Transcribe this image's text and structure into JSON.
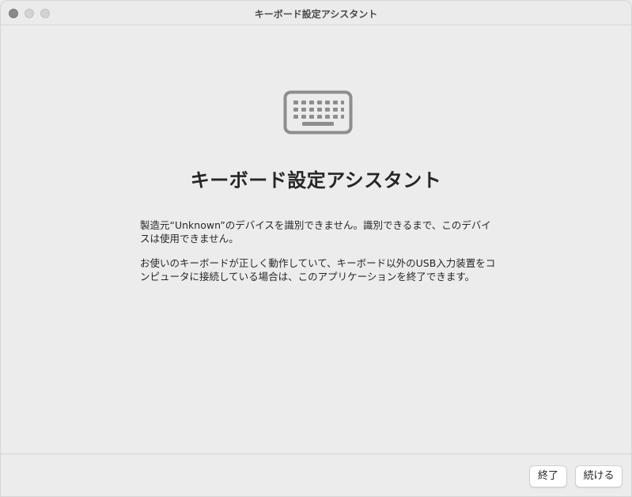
{
  "window": {
    "title": "キーボード設定アシスタント"
  },
  "main": {
    "icon": "keyboard-icon",
    "headline": "キーボード設定アシスタント",
    "paragraph1": "製造元“Unknown”のデバイスを識別できません。識別できるまで、このデバイスは使用できません。",
    "paragraph2": "お使いのキーボードが正しく動作していて、キーボード以外のUSB入力装置をコンピュータに接続している場合は、このアプリケーションを終了できます。"
  },
  "footer": {
    "quit_label": "終了",
    "continue_label": "続ける"
  },
  "colors": {
    "window_bg": "#ececec",
    "icon_stroke": "#8e8e8e",
    "button_bg": "#ffffff"
  }
}
